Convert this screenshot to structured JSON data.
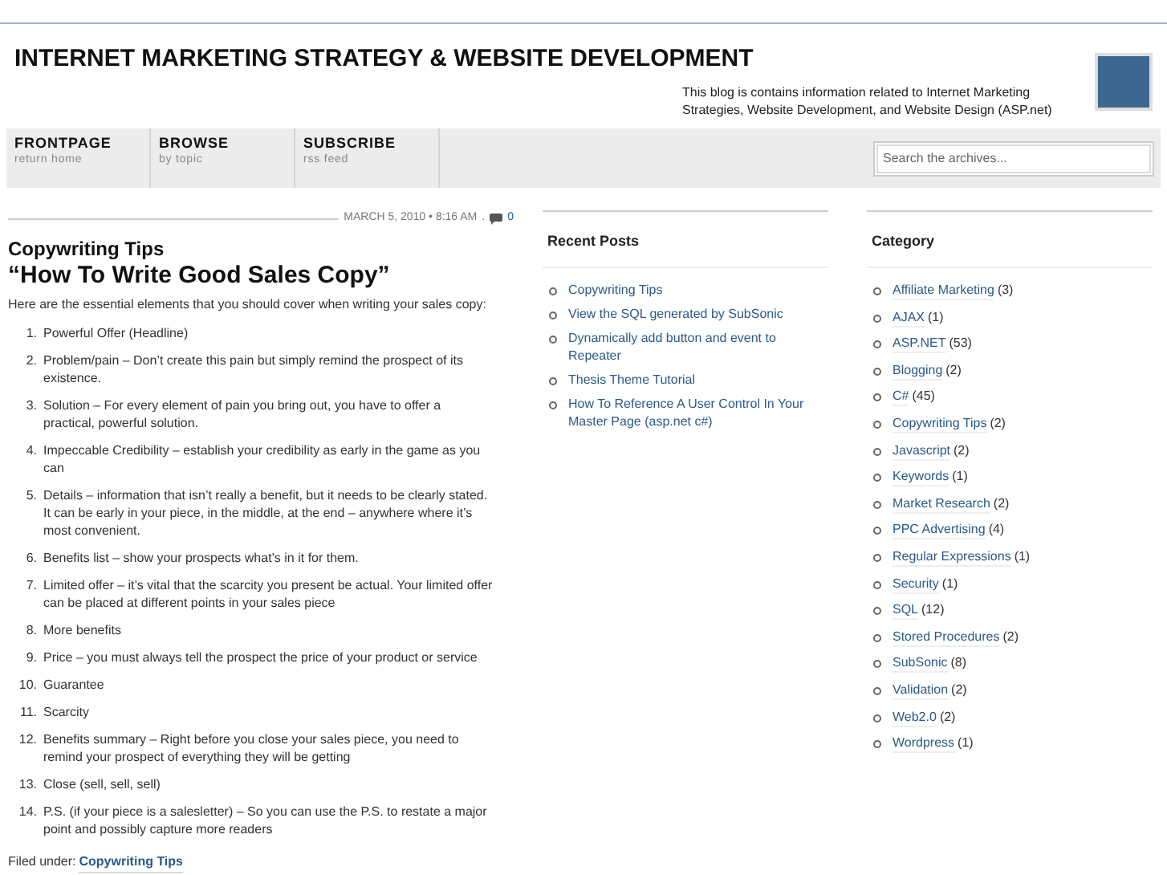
{
  "site": {
    "title": "INTERNET MARKETING STRATEGY & WEBSITE DEVELOPMENT",
    "description": "This blog is contains information related to Internet Marketing Strategies, Website Development, and Website Design (ASP.net)"
  },
  "nav": [
    {
      "label": "FRONTPAGE",
      "sub": "return home"
    },
    {
      "label": "BROWSE",
      "sub": "by topic"
    },
    {
      "label": "SUBSCRIBE",
      "sub": "rss feed"
    }
  ],
  "search": {
    "placeholder": "Search the archives..."
  },
  "post": {
    "date": "MARCH 5, 2010 • 8:16 AM",
    "separator": ".",
    "comments": "0",
    "title": "Copywriting Tips",
    "subtitle": "“How To Write Good Sales Copy”",
    "intro": "Here are the essential elements that you should cover when writing your sales copy:",
    "items": [
      {
        "num": "1.",
        "text": "Powerful Offer (Headline)"
      },
      {
        "num": "2.",
        "text": "Problem/pain – Don’t create this pain but simply remind the prospect of its existence."
      },
      {
        "num": "3.",
        "text": "Solution – For every element of pain you bring out, you have to offer a practical, powerful solution."
      },
      {
        "num": "4.",
        "text": "Impeccable Credibility – establish your credibility as early in the game as you can"
      },
      {
        "num": "5.",
        "text": "Details – information that isn’t really a benefit, but it needs to be clearly stated. It can be early in your piece, in the middle, at the end – anywhere where it’s most convenient."
      },
      {
        "num": "6.",
        "text": "Benefits list – show your prospects what’s in it for them."
      },
      {
        "num": "7.",
        "text": "Limited offer – it’s vital that the scarcity you present be actual. Your limited offer can be placed at different points in your sales piece"
      },
      {
        "num": "8.",
        "text": "More benefits"
      },
      {
        "num": "9.",
        "text": "Price – you must always tell the prospect the price of your product or service"
      },
      {
        "num": "10.",
        "text": "Guarantee"
      },
      {
        "num": "11.",
        "text": "Scarcity"
      },
      {
        "num": "12.",
        "text": "Benefits summary – Right before you close your sales piece, you need to remind your prospect of everything they will be getting"
      },
      {
        "num": "13.",
        "text": "Close (sell, sell, sell)"
      },
      {
        "num": "14.",
        "text": "P.S. (if your piece is a salesletter) – So you can use the P.S. to restate a major point and possibly capture more readers"
      }
    ],
    "filed_label": "Filed under:",
    "filed_link": "Copywriting Tips"
  },
  "recent": {
    "title": "Recent Posts",
    "items": [
      "Copywriting Tips",
      "View the SQL generated by SubSonic",
      "Dynamically add button and event to Repeater",
      "Thesis Theme Tutorial",
      "How To Reference A User Control In Your Master Page (asp.net c#)"
    ]
  },
  "category": {
    "title": "Category",
    "items": [
      {
        "name": "Affiliate Marketing",
        "count": "(3)"
      },
      {
        "name": "AJAX",
        "count": "(1)"
      },
      {
        "name": "ASP.NET",
        "count": "(53)"
      },
      {
        "name": "Blogging",
        "count": "(2)"
      },
      {
        "name": "C#",
        "count": "(45)"
      },
      {
        "name": "Copywriting Tips",
        "count": "(2)"
      },
      {
        "name": "Javascript",
        "count": "(2)"
      },
      {
        "name": "Keywords",
        "count": "(1)"
      },
      {
        "name": "Market Research",
        "count": "(2)"
      },
      {
        "name": "PPC Advertising",
        "count": "(4)"
      },
      {
        "name": "Regular Expressions",
        "count": "(1)"
      },
      {
        "name": "Security",
        "count": "(1)"
      },
      {
        "name": "SQL",
        "count": "(12)"
      },
      {
        "name": "Stored Procedures",
        "count": "(2)"
      },
      {
        "name": "SubSonic",
        "count": "(8)"
      },
      {
        "name": "Validation",
        "count": "(2)"
      },
      {
        "name": "Web2.0",
        "count": "(2)"
      },
      {
        "name": "Wordpress",
        "count": "(1)"
      }
    ]
  }
}
